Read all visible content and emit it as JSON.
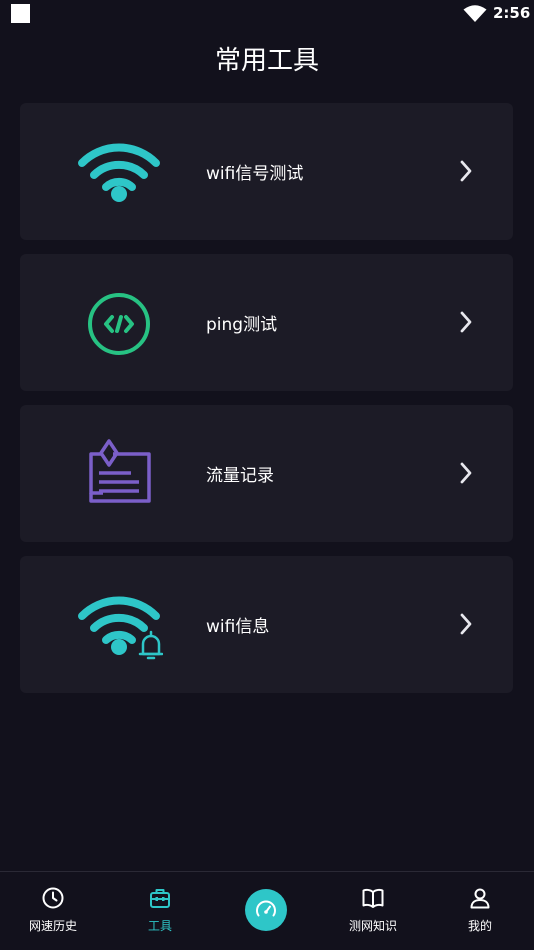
{
  "status_bar": {
    "time": "2:56"
  },
  "page": {
    "title": "常用工具"
  },
  "tools": [
    {
      "label": "wifi信号测试",
      "icon": "wifi-signal-icon"
    },
    {
      "label": "ping测试",
      "icon": "code-icon"
    },
    {
      "label": "流量记录",
      "icon": "traffic-record-icon"
    },
    {
      "label": "wifi信息",
      "icon": "wifi-info-icon"
    }
  ],
  "bottom_nav": {
    "items": [
      {
        "label": "网速历史",
        "icon": "clock-icon"
      },
      {
        "label": "工具",
        "icon": "toolbox-icon",
        "active": true
      },
      {
        "label": "",
        "icon": "speedometer-icon"
      },
      {
        "label": "测网知识",
        "icon": "book-icon"
      },
      {
        "label": "我的",
        "icon": "user-icon"
      }
    ]
  },
  "colors": {
    "background": "#12111c",
    "card": "#1c1b26",
    "accent_teal": "#2ec6c8",
    "accent_green": "#27c283",
    "accent_purple": "#7b5fc9"
  }
}
